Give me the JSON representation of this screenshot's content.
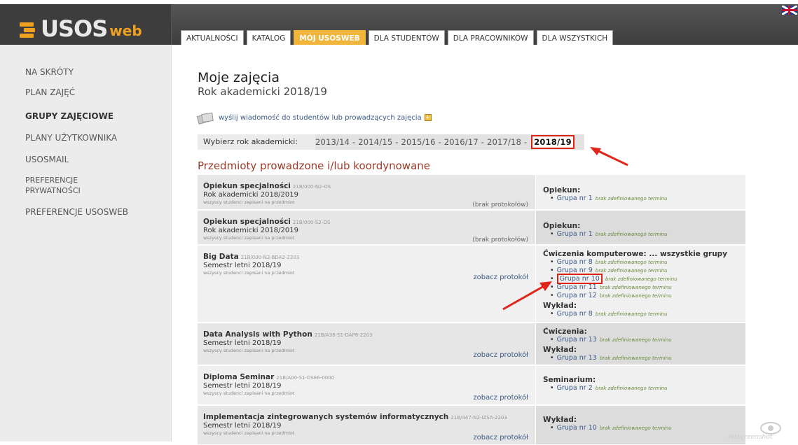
{
  "app": {
    "logo_main": "USOS",
    "logo_sub": "web"
  },
  "nav": {
    "tabs": [
      {
        "label": "AKTUALNOŚCI",
        "active": false
      },
      {
        "label": "KATALOG",
        "active": false
      },
      {
        "label": "MÓJ USOSWEB",
        "active": true
      },
      {
        "label": "DLA STUDENTÓW",
        "active": false
      },
      {
        "label": "DLA PRACOWNIKÓW",
        "active": false
      },
      {
        "label": "DLA WSZYSTKICH",
        "active": false
      }
    ]
  },
  "sidebar": {
    "items": [
      {
        "label": "NA SKRÓTY",
        "active": false
      },
      {
        "label": "PLAN ZAJĘĆ",
        "active": false
      },
      {
        "label": "GRUPY ZAJĘCIOWE",
        "active": true
      },
      {
        "label": "PLANY UŻYTKOWNIKA",
        "active": false
      },
      {
        "label": "USOSMAIL",
        "active": false
      },
      {
        "label": "PREFERENCJE PRYWATNOŚCI",
        "active": false
      },
      {
        "label": "PREFERENCJE USOSWEB",
        "active": false
      }
    ]
  },
  "main": {
    "title": "Moje zajęcia",
    "subtitle": "Rok akademicki 2018/19",
    "message_link": "wyślij wiadomość do studentów lub prowadzących zajęcia",
    "year_label": "Wybierz rok akademicki:",
    "years_text": "2013/14 - 2014/15 - 2015/16 - 2016/17 - 2017/18 -",
    "year_selected": "2018/19",
    "section_title": "Przedmioty prowadzone i/lub koordynowane",
    "courses": [
      {
        "name": "Opiekun specjalności",
        "code": "21B/000-N2-OS",
        "term": "Rok akademicki 2018/2019",
        "note": "wszyscy studenci zapisani na przedmiot",
        "protocol": "(brak protokołów)",
        "protocol_link": false,
        "groups": [
          {
            "type": "Opiekun:",
            "items": [
              {
                "label": "Grupa nr 1",
                "nodate": "brak zdefiniowanego terminu"
              }
            ]
          }
        ]
      },
      {
        "name": "Opiekun specjalności",
        "code": "21B/000-S2-OS",
        "term": "Rok akademicki 2018/2019",
        "note": "wszyscy studenci zapisani na przedmiot",
        "protocol": "(brak protokołów)",
        "protocol_link": false,
        "groups": [
          {
            "type": "Opiekun:",
            "items": [
              {
                "label": "Grupa nr 1",
                "nodate": "brak zdefiniowanego terminu"
              }
            ]
          }
        ]
      },
      {
        "name": "Big Data",
        "code": "21B/000-N2-BDA2-2203",
        "term": "Semestr letni 2018/19",
        "note": "wszyscy studenci zapisani na przedmiot",
        "protocol": "zobacz protokół",
        "protocol_link": true,
        "groups": [
          {
            "type": "Ćwiczenia komputerowe:",
            "all_link": "... wszystkie grupy",
            "items": [
              {
                "label": "Grupa nr 8",
                "nodate": "brak zdefiniowanego terminu"
              },
              {
                "label": "Grupa nr 9",
                "nodate": "brak zdefiniowanego terminu"
              },
              {
                "label": "Grupa nr 10",
                "nodate": "brak zdefiniowanego terminu",
                "highlight": true
              },
              {
                "label": "Grupa nr 11",
                "nodate": "brak zdefiniowanego terminu"
              },
              {
                "label": "Grupa nr 12",
                "nodate": "brak zdefiniowanego terminu"
              }
            ]
          },
          {
            "type": "Wykład:",
            "items": [
              {
                "label": "Grupa nr 8",
                "nodate": "brak zdefiniowanego terminu"
              }
            ]
          }
        ]
      },
      {
        "name": "Data Analysis with Python",
        "code": "21B/A36-S1-DAP6-2203",
        "term": "Semestr letni 2018/19",
        "note": "wszyscy studenci zapisani na przedmiot",
        "protocol": "zobacz protokół",
        "protocol_link": true,
        "groups": [
          {
            "type": "Ćwiczenia:",
            "items": [
              {
                "label": "Grupa nr 13",
                "nodate": "brak zdefiniowanego terminu"
              }
            ]
          },
          {
            "type": "Wykład:",
            "items": [
              {
                "label": "Grupa nr 13",
                "nodate": "brak zdefiniowanego terminu"
              }
            ]
          }
        ]
      },
      {
        "name": "Diploma Seminar",
        "code": "21B/A00-S1-DSE6-0000",
        "term": "Semestr letni 2018/19",
        "note": "wszyscy studenci zapisani na przedmiot",
        "protocol": "zobacz protokół",
        "protocol_link": true,
        "groups": [
          {
            "type": "Seminarium:",
            "items": [
              {
                "label": "Grupa nr 2",
                "nodate": "brak zdefiniowanego terminu"
              }
            ]
          }
        ]
      },
      {
        "name": "Implementacja zintegrowanych systemów informatycznych",
        "code": "21B/447-N2-IZSA-2203",
        "term": "Semestr letni 2018/19",
        "note": "wszyscy studenci zapisani na przedmiot",
        "protocol": "zobacz protokół",
        "protocol_link": true,
        "groups": [
          {
            "type": "Wykład:",
            "items": [
              {
                "label": "Grupa nr 10",
                "nodate": "brak zdefiniowanego terminu"
              }
            ]
          }
        ]
      }
    ]
  },
  "watermark": "JetScreenshot",
  "colors": {
    "accent_tab": "#f0b53a",
    "section_title": "#a03a2a",
    "link": "#3a5a8a",
    "highlight": "#dd2211"
  }
}
